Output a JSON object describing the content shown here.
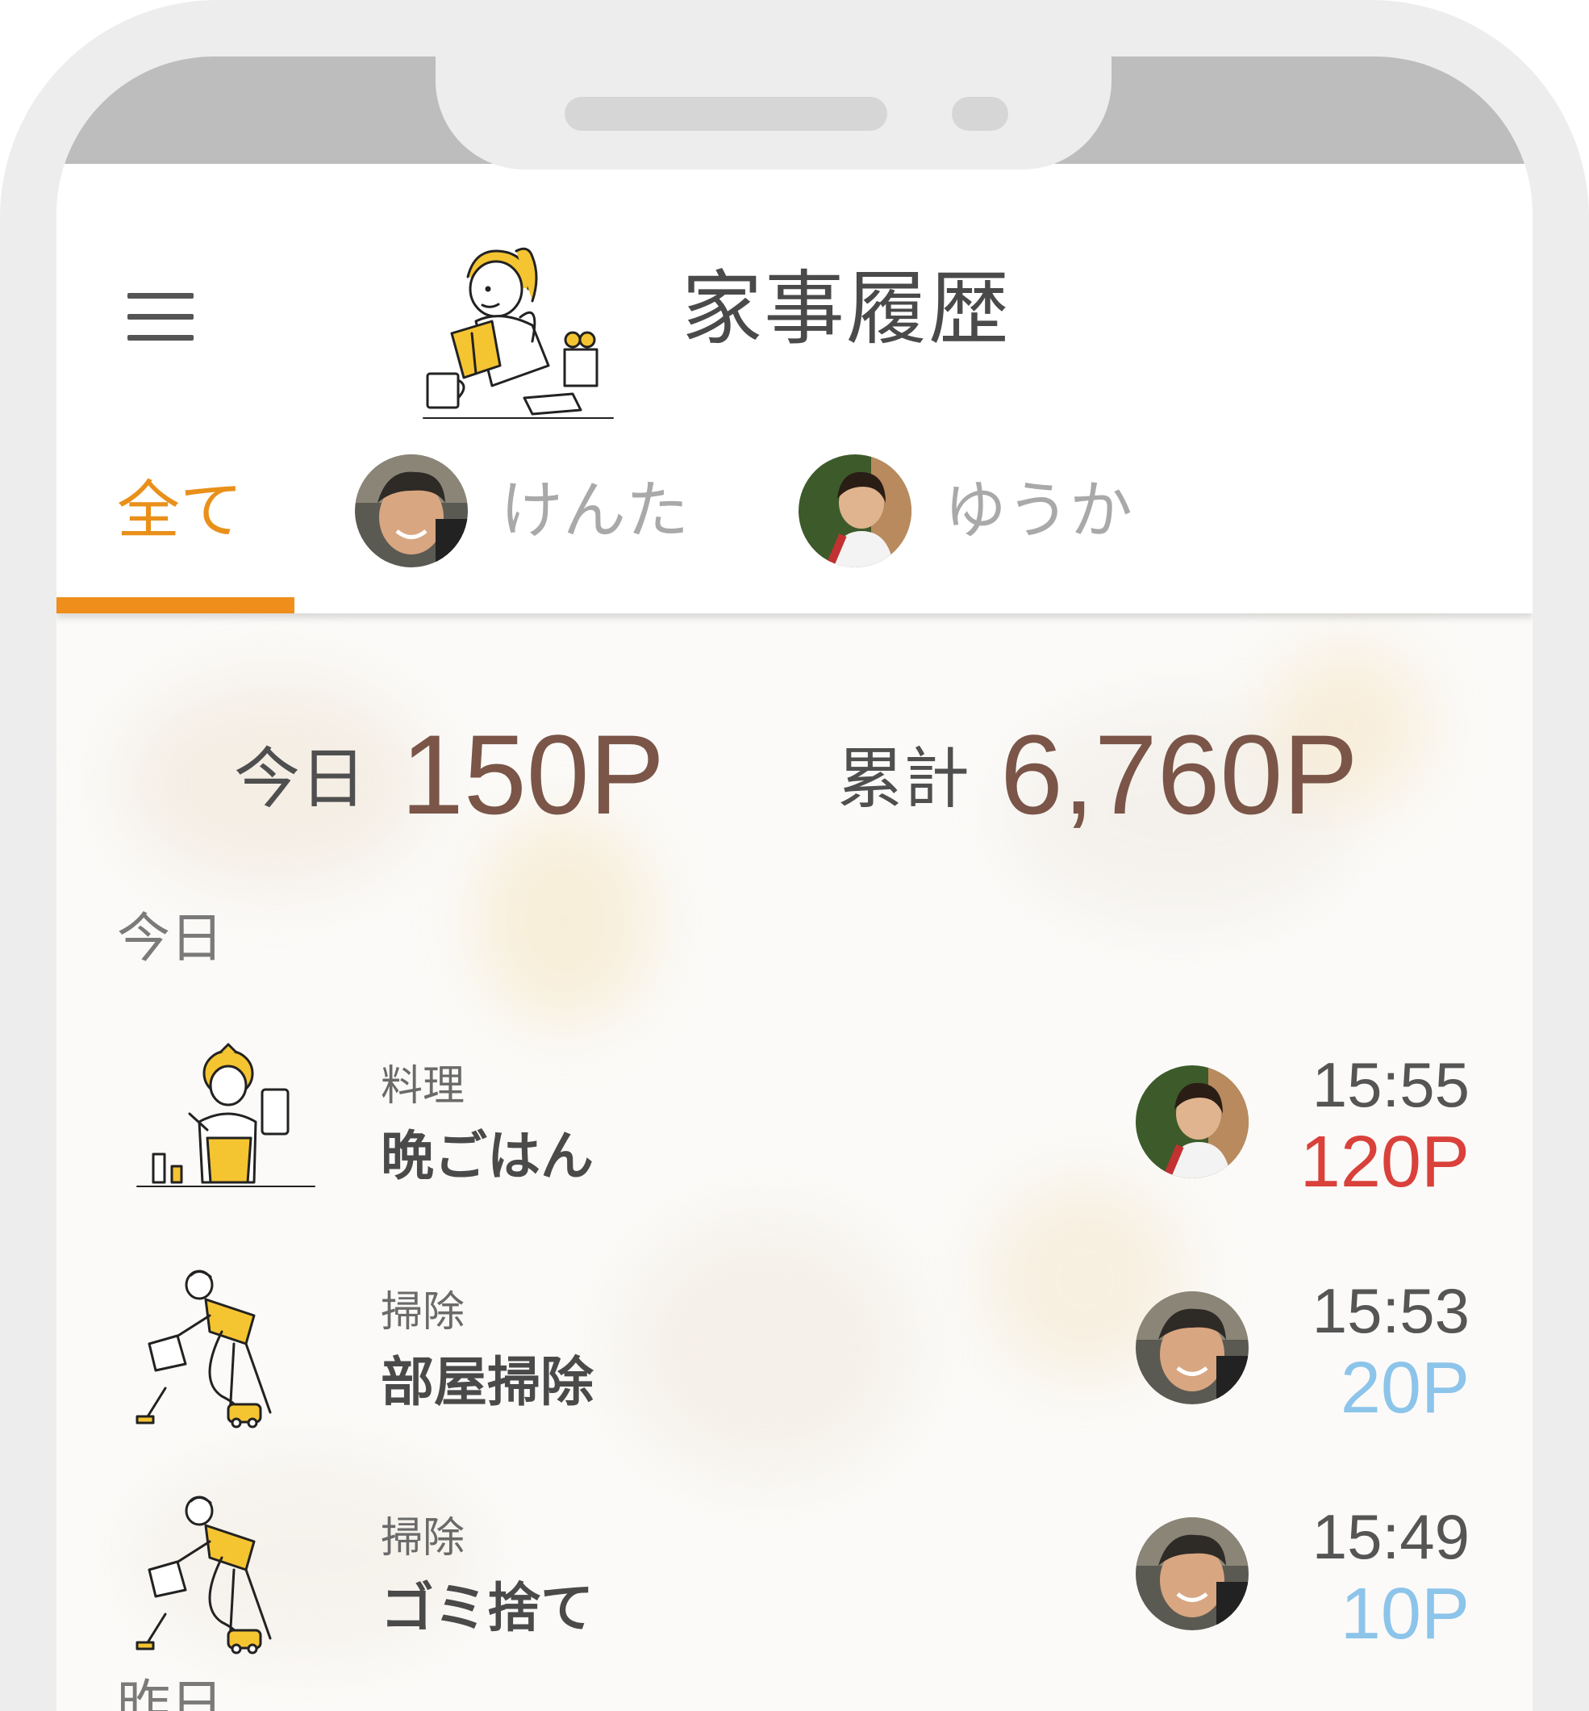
{
  "header": {
    "title": "家事履歴",
    "menu_icon": "hamburger-menu-icon"
  },
  "tabs": [
    {
      "label": "全て",
      "active": true
    },
    {
      "label": "けんた",
      "active": false,
      "avatar": "kenta-avatar"
    },
    {
      "label": "ゆうか",
      "active": false,
      "avatar": "yuka-avatar"
    }
  ],
  "summary": {
    "today_label": "今日",
    "today_value": "150P",
    "total_label": "累計",
    "total_value": "6,760P"
  },
  "sections": [
    {
      "label": "今日",
      "items": [
        {
          "category": "料理",
          "name": "晩ごはん",
          "user": "ゆうか",
          "time": "15:55",
          "points": "120P",
          "points_color": "#d9413a"
        },
        {
          "category": "掃除",
          "name": "部屋掃除",
          "user": "けんた",
          "time": "15:53",
          "points": "20P",
          "points_color": "#8cc4ea"
        },
        {
          "category": "掃除",
          "name": "ゴミ捨て",
          "user": "けんた",
          "time": "15:49",
          "points": "10P",
          "points_color": "#8cc4ea"
        }
      ]
    },
    {
      "label": "昨日",
      "items": []
    }
  ],
  "colors": {
    "accent": "#ef8e1a",
    "points_value": "#7a5548",
    "high_points": "#d9413a",
    "low_points": "#8cc4ea"
  }
}
